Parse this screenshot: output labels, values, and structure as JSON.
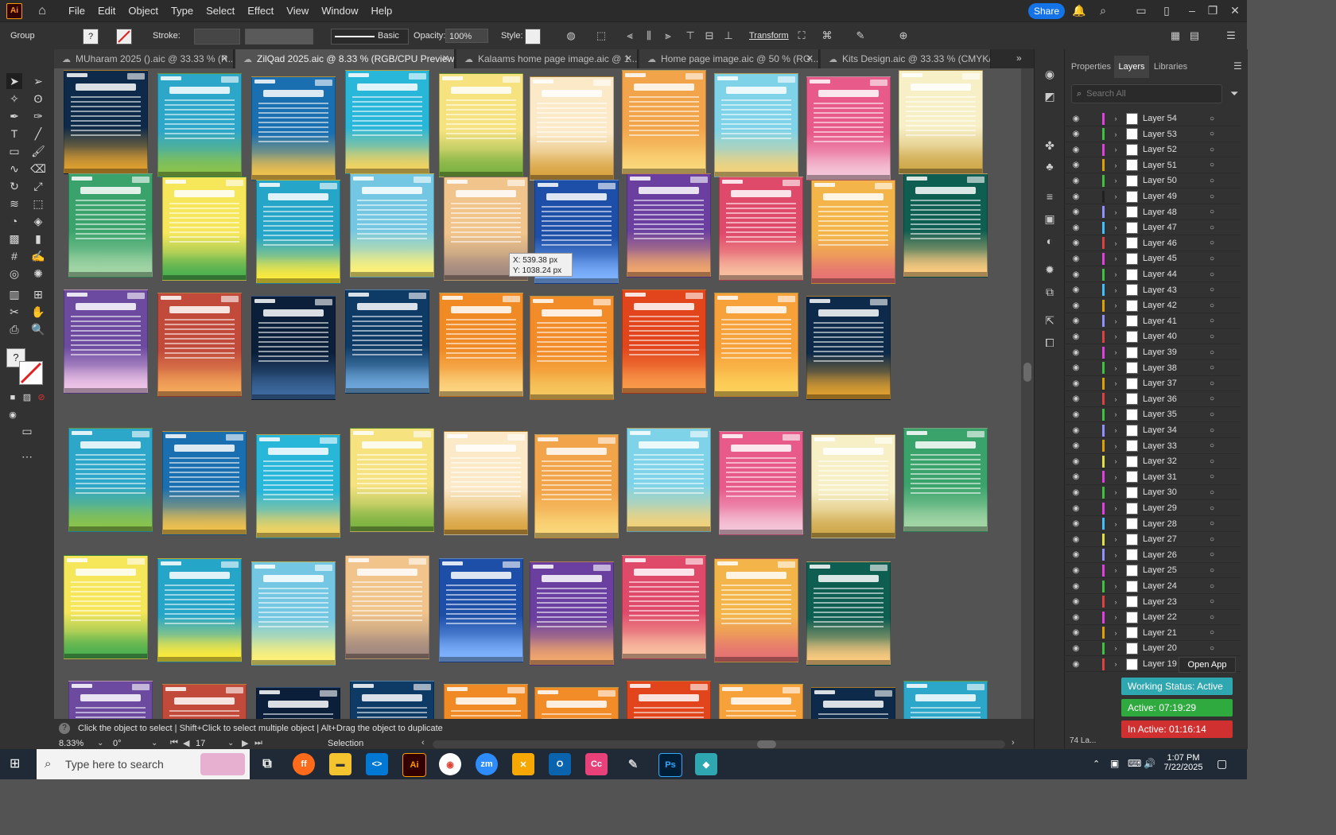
{
  "menu": {
    "app_icon": "Ai",
    "items": [
      "File",
      "Edit",
      "Object",
      "Type",
      "Select",
      "Effect",
      "View",
      "Window",
      "Help"
    ],
    "share_label": "Share"
  },
  "control_bar": {
    "group_label": "Group",
    "stroke_label": "Stroke:",
    "brush_label": "Basic",
    "opacity_label": "Opacity:",
    "opacity_value": "100%",
    "style_label": "Style:",
    "transform_label": "Transform"
  },
  "tabs": [
    {
      "label": "MUharam 2025 ().aic @ 33.33 % (R..."
    },
    {
      "label": "ZilQad 2025.aic @ 8.33 % (RGB/CPU Preview)"
    },
    {
      "label": "Kalaams home page image.aic @ 1..."
    },
    {
      "label": "Home page image.aic @ 50 % (RG..."
    },
    {
      "label": "Kits Design.aic @ 33.33 % (CMYK/..."
    }
  ],
  "panel": {
    "tabs": [
      "Properties",
      "Layers",
      "Libraries"
    ],
    "search_placeholder": "Search All",
    "layers": [
      {
        "name": "Layer 54",
        "color": "#e040e0"
      },
      {
        "name": "Layer 53",
        "color": "#40c040"
      },
      {
        "name": "Layer 52",
        "color": "#e040e0"
      },
      {
        "name": "Layer 51",
        "color": "#e0a000"
      },
      {
        "name": "Layer 50",
        "color": "#40c040"
      },
      {
        "name": "Layer 49",
        "color": "#202020"
      },
      {
        "name": "Layer 48",
        "color": "#9090ff"
      },
      {
        "name": "Layer 47",
        "color": "#40c0ff"
      },
      {
        "name": "Layer 46",
        "color": "#e04040"
      },
      {
        "name": "Layer 45",
        "color": "#e040e0"
      },
      {
        "name": "Layer 44",
        "color": "#40c040"
      },
      {
        "name": "Layer 43",
        "color": "#40c0ff"
      },
      {
        "name": "Layer 42",
        "color": "#e0a000"
      },
      {
        "name": "Layer 41",
        "color": "#9090ff"
      },
      {
        "name": "Layer 40",
        "color": "#e04040"
      },
      {
        "name": "Layer 39",
        "color": "#e040e0"
      },
      {
        "name": "Layer 38",
        "color": "#40c040"
      },
      {
        "name": "Layer 37",
        "color": "#e0a000"
      },
      {
        "name": "Layer 36",
        "color": "#e04040"
      },
      {
        "name": "Layer 35",
        "color": "#40c040"
      },
      {
        "name": "Layer 34",
        "color": "#9090ff"
      },
      {
        "name": "Layer 33",
        "color": "#e0a000"
      },
      {
        "name": "Layer 32",
        "color": "#e0e040"
      },
      {
        "name": "Layer 31",
        "color": "#e040e0"
      },
      {
        "name": "Layer 30",
        "color": "#40c040"
      },
      {
        "name": "Layer 29",
        "color": "#e040e0"
      },
      {
        "name": "Layer 28",
        "color": "#40c0ff"
      },
      {
        "name": "Layer 27",
        "color": "#e0e040"
      },
      {
        "name": "Layer 26",
        "color": "#9090ff"
      },
      {
        "name": "Layer 25",
        "color": "#e040e0"
      },
      {
        "name": "Layer 24",
        "color": "#40c040"
      },
      {
        "name": "Layer 23",
        "color": "#e04040"
      },
      {
        "name": "Layer 22",
        "color": "#e040e0"
      },
      {
        "name": "Layer 21",
        "color": "#e0a000"
      },
      {
        "name": "Layer 20",
        "color": "#40c040"
      },
      {
        "name": "Layer 19",
        "color": "#e04040"
      }
    ],
    "layers_count": "74 La...",
    "open_app": "Open App"
  },
  "overlay": {
    "working_status": "Working Status: Active",
    "active": "Active: 07:19:29",
    "inactive": "In Active: 01:16:14"
  },
  "tooltip": {
    "x": "X: 539.38 px",
    "y": "Y: 1038.24 px"
  },
  "status_bar": {
    "hint": "Click the object to select  |  Shift+Click to select multiple object  |  Alt+Drag the object to duplicate",
    "zoom": "8.33%",
    "rotation": "0°",
    "artboard": "17",
    "mode": "Selection"
  },
  "taskbar": {
    "search_placeholder": "Type here to search",
    "time": "1:07 PM",
    "date": "7/22/2025"
  },
  "colors": {
    "share": "#1473e6",
    "canvas": "#535353",
    "working_status": "#2fa7b0",
    "active": "#2eaa3e",
    "inactive": "#d03030"
  }
}
